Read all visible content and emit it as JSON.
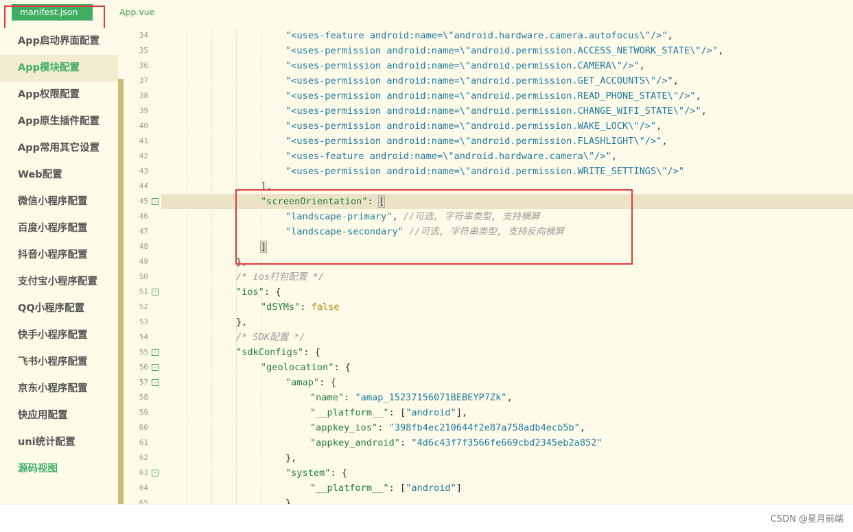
{
  "tabs": [
    {
      "label": "manifest.json",
      "active": true
    },
    {
      "label": "App.vue",
      "active": false
    }
  ],
  "sidebar": {
    "items": [
      {
        "label": "App启动界面配置"
      },
      {
        "label": "App模块配置",
        "active": true
      },
      {
        "label": "App权限配置"
      },
      {
        "label": "App原生插件配置"
      },
      {
        "label": "App常用其它设置"
      },
      {
        "label": "Web配置"
      },
      {
        "label": "微信小程序配置"
      },
      {
        "label": "百度小程序配置"
      },
      {
        "label": "抖音小程序配置"
      },
      {
        "label": "支付宝小程序配置"
      },
      {
        "label": "QQ小程序配置"
      },
      {
        "label": "快手小程序配置"
      },
      {
        "label": "飞书小程序配置"
      },
      {
        "label": "京东小程序配置"
      },
      {
        "label": "快应用配置"
      },
      {
        "label": "uni统计配置"
      },
      {
        "label": "源码视图",
        "green": true
      }
    ]
  },
  "editor": {
    "lines": [
      {
        "n": "34",
        "indent": 5,
        "tokens": [
          [
            "s",
            "\"<uses-feature android:name=\\\"android.hardware.camera.autofocus\\\"/>\""
          ],
          [
            "p",
            ","
          ]
        ]
      },
      {
        "n": "35",
        "indent": 5,
        "tokens": [
          [
            "s",
            "\"<uses-permission android:name=\\\"android.permission.ACCESS_NETWORK_STATE\\\"/>\""
          ],
          [
            "p",
            ","
          ]
        ]
      },
      {
        "n": "36",
        "indent": 5,
        "tokens": [
          [
            "s",
            "\"<uses-permission android:name=\\\"android.permission.CAMERA\\\"/>\""
          ],
          [
            "p",
            ","
          ]
        ]
      },
      {
        "n": "37",
        "indent": 5,
        "tokens": [
          [
            "s",
            "\"<uses-permission android:name=\\\"android.permission.GET_ACCOUNTS\\\"/>\""
          ],
          [
            "p",
            ","
          ]
        ]
      },
      {
        "n": "38",
        "indent": 5,
        "tokens": [
          [
            "s",
            "\"<uses-permission android:name=\\\"android.permission.READ_PHONE_STATE\\\"/>\""
          ],
          [
            "p",
            ","
          ]
        ]
      },
      {
        "n": "39",
        "indent": 5,
        "tokens": [
          [
            "s",
            "\"<uses-permission android:name=\\\"android.permission.CHANGE_WIFI_STATE\\\"/>\""
          ],
          [
            "p",
            ","
          ]
        ]
      },
      {
        "n": "40",
        "indent": 5,
        "tokens": [
          [
            "s",
            "\"<uses-permission android:name=\\\"android.permission.WAKE_LOCK\\\"/>\""
          ],
          [
            "p",
            ","
          ]
        ]
      },
      {
        "n": "41",
        "indent": 5,
        "tokens": [
          [
            "s",
            "\"<uses-permission android:name=\\\"android.permission.FLASHLIGHT\\\"/>\""
          ],
          [
            "p",
            ","
          ]
        ]
      },
      {
        "n": "42",
        "indent": 5,
        "tokens": [
          [
            "s",
            "\"<uses-feature android:name=\\\"android.hardware.camera\\\"/>\""
          ],
          [
            "p",
            ","
          ]
        ]
      },
      {
        "n": "43",
        "indent": 5,
        "tokens": [
          [
            "s",
            "\"<uses-permission android:name=\\\"android.permission.WRITE_SETTINGS\\\"/>\""
          ]
        ]
      },
      {
        "n": "44",
        "indent": 4,
        "tokens": [
          [
            "p",
            "],"
          ]
        ]
      },
      {
        "n": "45",
        "indent": 4,
        "fold": true,
        "highlight": true,
        "tokens": [
          [
            "k",
            "\"screenOrientation\""
          ],
          [
            "p",
            ": "
          ],
          [
            "br",
            "["
          ]
        ]
      },
      {
        "n": "46",
        "indent": 5,
        "tokens": [
          [
            "s",
            "\"landscape-primary\""
          ],
          [
            "p",
            ", "
          ],
          [
            "c",
            "//可选, 字符串类型, 支持横屏"
          ]
        ]
      },
      {
        "n": "47",
        "indent": 5,
        "tokens": [
          [
            "s",
            "\"landscape-secondary\""
          ],
          [
            "p",
            " "
          ],
          [
            "c",
            "//可选, 字符串类型, 支持反向横屏"
          ]
        ]
      },
      {
        "n": "48",
        "indent": 4,
        "tokens": [
          [
            "br",
            "]"
          ]
        ]
      },
      {
        "n": "49",
        "indent": 3,
        "tokens": [
          [
            "p",
            "},"
          ]
        ]
      },
      {
        "n": "50",
        "indent": 3,
        "tokens": [
          [
            "c",
            "/* ios打包配置 */"
          ]
        ]
      },
      {
        "n": "51",
        "indent": 3,
        "fold": true,
        "tokens": [
          [
            "k",
            "\"ios\""
          ],
          [
            "p",
            ": {"
          ]
        ]
      },
      {
        "n": "52",
        "indent": 4,
        "tokens": [
          [
            "k",
            "\"dSYMs\""
          ],
          [
            "p",
            ": "
          ],
          [
            "b",
            "false"
          ]
        ]
      },
      {
        "n": "53",
        "indent": 3,
        "tokens": [
          [
            "p",
            "},"
          ]
        ]
      },
      {
        "n": "54",
        "indent": 3,
        "tokens": [
          [
            "c",
            "/* SDK配置 */"
          ]
        ]
      },
      {
        "n": "55",
        "indent": 3,
        "fold": true,
        "tokens": [
          [
            "k",
            "\"sdkConfigs\""
          ],
          [
            "p",
            ": {"
          ]
        ]
      },
      {
        "n": "56",
        "indent": 4,
        "fold": true,
        "tokens": [
          [
            "k",
            "\"geolocation\""
          ],
          [
            "p",
            ": {"
          ]
        ]
      },
      {
        "n": "57",
        "indent": 5,
        "fold": true,
        "tokens": [
          [
            "k",
            "\"amap\""
          ],
          [
            "p",
            ": {"
          ]
        ]
      },
      {
        "n": "58",
        "indent": 6,
        "tokens": [
          [
            "k",
            "\"name\""
          ],
          [
            "p",
            ": "
          ],
          [
            "s",
            "\"amap_15237156071BEBEYP7Zk\""
          ],
          [
            "p",
            ","
          ]
        ]
      },
      {
        "n": "59",
        "indent": 6,
        "tokens": [
          [
            "k",
            "\"__platform__\""
          ],
          [
            "p",
            ": ["
          ],
          [
            "s",
            "\"android\""
          ],
          [
            "p",
            "],"
          ]
        ]
      },
      {
        "n": "60",
        "indent": 6,
        "tokens": [
          [
            "k",
            "\"appkey_ios\""
          ],
          [
            "p",
            ": "
          ],
          [
            "s",
            "\"398fb4ec210644f2e87a758adb4ecb5b\""
          ],
          [
            "p",
            ","
          ]
        ]
      },
      {
        "n": "61",
        "indent": 6,
        "tokens": [
          [
            "k",
            "\"appkey_android\""
          ],
          [
            "p",
            ": "
          ],
          [
            "s",
            "\"4d6c43f7f3566fe669cbd2345eb2a852\""
          ]
        ]
      },
      {
        "n": "62",
        "indent": 5,
        "tokens": [
          [
            "p",
            "},"
          ]
        ]
      },
      {
        "n": "63",
        "indent": 5,
        "fold": true,
        "tokens": [
          [
            "k",
            "\"system\""
          ],
          [
            "p",
            ": {"
          ]
        ]
      },
      {
        "n": "64",
        "indent": 6,
        "tokens": [
          [
            "k",
            "\"__platform__\""
          ],
          [
            "p",
            ": ["
          ],
          [
            "s",
            "\"android\""
          ],
          [
            "p",
            "]"
          ]
        ]
      },
      {
        "n": "65",
        "indent": 5,
        "tokens": [
          [
            "p",
            "}"
          ]
        ]
      }
    ]
  },
  "footer": {
    "watermark": "CSDN @星月前端"
  }
}
